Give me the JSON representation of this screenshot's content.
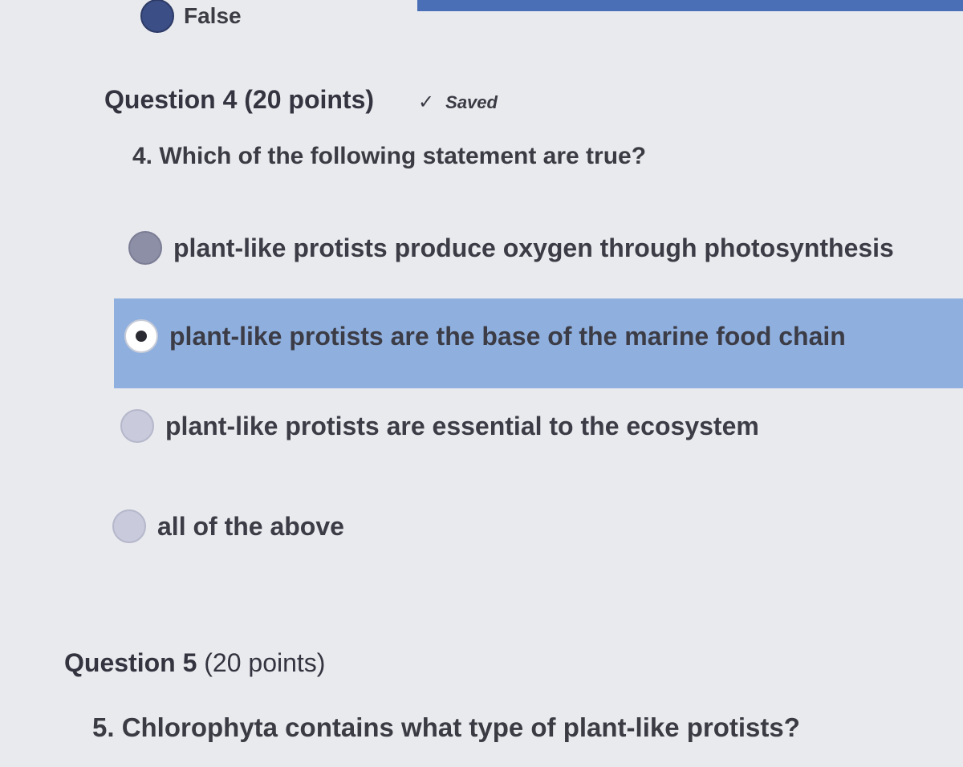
{
  "question3": {
    "option_label": "False"
  },
  "question4": {
    "header_title": "Question 4",
    "header_points": "(20 points)",
    "saved_label": "Saved",
    "text": "4. Which of the following statement are true?",
    "options": [
      {
        "label": "plant-like protists produce oxygen through photosynthesis",
        "selected": false
      },
      {
        "label": "plant-like protists are the base of the marine food chain",
        "selected": true
      },
      {
        "label": "plant-like protists are essential to the ecosystem",
        "selected": false
      },
      {
        "label": "all of the above",
        "selected": false
      }
    ]
  },
  "question5": {
    "header_title": "Question 5",
    "header_points": "(20 points)",
    "text": "5. Chlorophyta contains what type of plant-like protists?"
  },
  "colors": {
    "background": "#e9eaee",
    "selected_highlight": "#8fb0df",
    "accent_bar": "#4a6fb7"
  },
  "icons": {
    "saved": "check-icon"
  }
}
